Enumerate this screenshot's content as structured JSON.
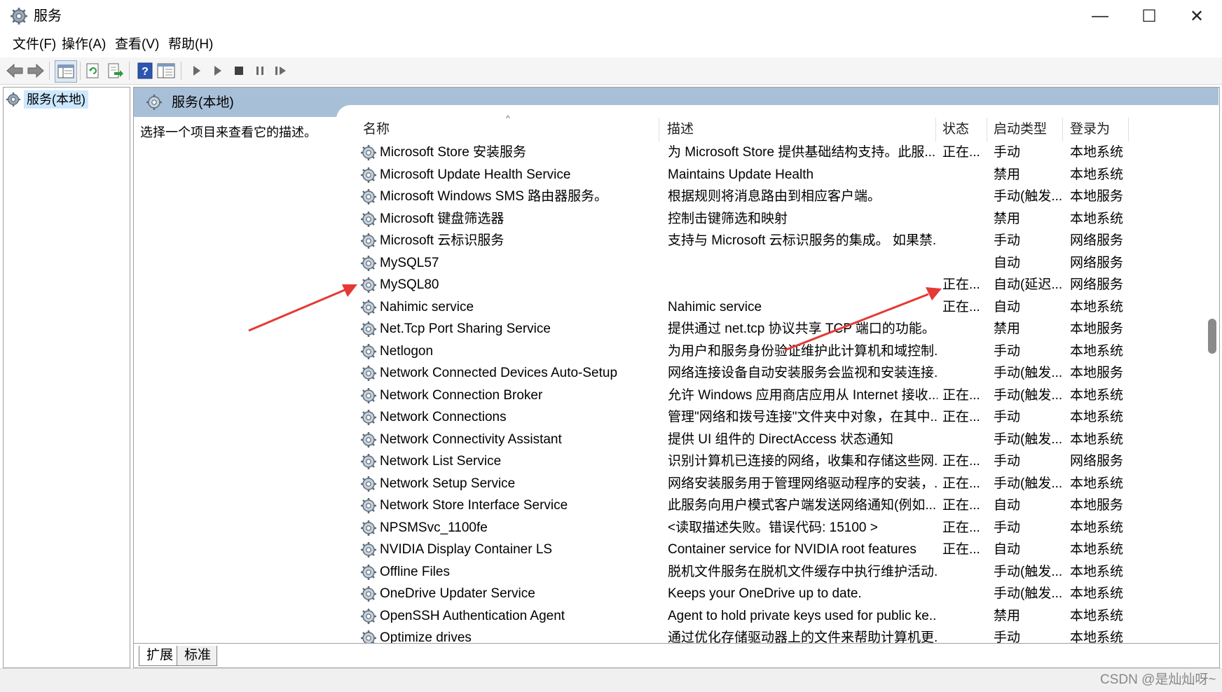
{
  "window": {
    "title": "服务",
    "min_label": "—",
    "max_label": "☐",
    "close_label": "✕"
  },
  "menu": [
    "文件(F)",
    "操作(A)",
    "查看(V)",
    "帮助(H)"
  ],
  "toolbar_icons": [
    "back-arrow-icon",
    "forward-arrow-icon",
    "show-console-tree-icon",
    "refresh-icon",
    "export-list-icon",
    "help-icon",
    "properties-icon",
    "start-service-icon",
    "start-service-alt-icon",
    "stop-service-icon",
    "pause-service-icon",
    "restart-service-icon"
  ],
  "tree": {
    "label": "服务(本地)"
  },
  "right_panel": {
    "title": "服务(本地)",
    "description": "选择一个项目来查看它的描述。",
    "columns": {
      "name": "名称",
      "desc": "描述",
      "status": "状态",
      "startup": "启动类型",
      "logon": "登录为"
    },
    "sort_indicator": "^"
  },
  "services": [
    {
      "name": "Microsoft Store 安装服务",
      "desc": "为 Microsoft Store 提供基础结构支持。此服...",
      "status": "正在...",
      "startup": "手动",
      "logon": "本地系统"
    },
    {
      "name": "Microsoft Update Health Service",
      "desc": "Maintains Update Health",
      "status": "",
      "startup": "禁用",
      "logon": "本地系统"
    },
    {
      "name": "Microsoft Windows SMS 路由器服务。",
      "desc": "根据规则将消息路由到相应客户端。",
      "status": "",
      "startup": "手动(触发...",
      "logon": "本地服务"
    },
    {
      "name": "Microsoft 键盘筛选器",
      "desc": "控制击键筛选和映射",
      "status": "",
      "startup": "禁用",
      "logon": "本地系统"
    },
    {
      "name": "Microsoft 云标识服务",
      "desc": "支持与 Microsoft 云标识服务的集成。 如果禁...",
      "status": "",
      "startup": "手动",
      "logon": "网络服务"
    },
    {
      "name": "MySQL57",
      "desc": "",
      "status": "",
      "startup": "自动",
      "logon": "网络服务"
    },
    {
      "name": "MySQL80",
      "desc": "",
      "status": "正在...",
      "startup": "自动(延迟...",
      "logon": "网络服务"
    },
    {
      "name": "Nahimic service",
      "desc": "Nahimic service",
      "status": "正在...",
      "startup": "自动",
      "logon": "本地系统"
    },
    {
      "name": "Net.Tcp Port Sharing Service",
      "desc": "提供通过 net.tcp 协议共享 TCP 端口的功能。",
      "status": "",
      "startup": "禁用",
      "logon": "本地服务"
    },
    {
      "name": "Netlogon",
      "desc": "为用户和服务身份验证维护此计算机和域控制...",
      "status": "",
      "startup": "手动",
      "logon": "本地系统"
    },
    {
      "name": "Network Connected Devices Auto-Setup",
      "desc": "网络连接设备自动安装服务会监视和安装连接...",
      "status": "",
      "startup": "手动(触发...",
      "logon": "本地服务"
    },
    {
      "name": "Network Connection Broker",
      "desc": "允许 Windows 应用商店应用从 Internet 接收...",
      "status": "正在...",
      "startup": "手动(触发...",
      "logon": "本地系统"
    },
    {
      "name": "Network Connections",
      "desc": "管理\"网络和拨号连接\"文件夹中对象，在其中...",
      "status": "正在...",
      "startup": "手动",
      "logon": "本地系统"
    },
    {
      "name": "Network Connectivity Assistant",
      "desc": "提供 UI 组件的 DirectAccess 状态通知",
      "status": "",
      "startup": "手动(触发...",
      "logon": "本地系统"
    },
    {
      "name": "Network List Service",
      "desc": "识别计算机已连接的网络，收集和存储这些网...",
      "status": "正在...",
      "startup": "手动",
      "logon": "网络服务"
    },
    {
      "name": "Network Setup Service",
      "desc": "网络安装服务用于管理网络驱动程序的安装，...",
      "status": "正在...",
      "startup": "手动(触发...",
      "logon": "本地系统"
    },
    {
      "name": "Network Store Interface Service",
      "desc": "此服务向用户模式客户端发送网络通知(例如...",
      "status": "正在...",
      "startup": "自动",
      "logon": "本地服务"
    },
    {
      "name": "NPSMSvc_1100fe",
      "desc": "<读取描述失败。错误代码: 15100 >",
      "status": "正在...",
      "startup": "手动",
      "logon": "本地系统"
    },
    {
      "name": "NVIDIA Display Container LS",
      "desc": "Container service for NVIDIA root features",
      "status": "正在...",
      "startup": "自动",
      "logon": "本地系统"
    },
    {
      "name": "Offline Files",
      "desc": "脱机文件服务在脱机文件缓存中执行维护活动...",
      "status": "",
      "startup": "手动(触发...",
      "logon": "本地系统"
    },
    {
      "name": "OneDrive Updater Service",
      "desc": "Keeps your OneDrive up to date.",
      "status": "",
      "startup": "手动(触发...",
      "logon": "本地系统"
    },
    {
      "name": "OpenSSH Authentication Agent",
      "desc": "Agent to hold private keys used for public ke...",
      "status": "",
      "startup": "禁用",
      "logon": "本地系统"
    },
    {
      "name": "Optimize drives",
      "desc": "通过优化存储驱动器上的文件来帮助计算机更...",
      "status": "",
      "startup": "手动",
      "logon": "本地系统"
    }
  ],
  "tabs": [
    "扩展",
    "标准"
  ],
  "watermark": "CSDN @是灿灿呀~",
  "colors": {
    "header_bg": "#a8bfd8",
    "selection": "#cce8ff",
    "arrow": "#e53935"
  }
}
